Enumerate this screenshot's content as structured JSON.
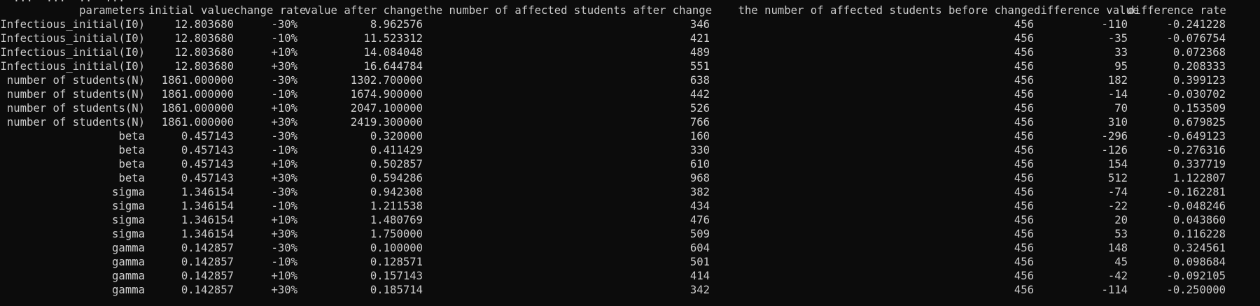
{
  "terminal": {
    "background": "#0c0c0c",
    "foreground": "#cccccc",
    "clipped_line": "  ...  ...  ..  ..."
  },
  "table": {
    "headers": [
      "parameters",
      "initial value",
      "change rate",
      "value after change",
      "the number of affected students after change",
      "the number of affected students before change",
      "difference value",
      "difference rate"
    ],
    "rows": [
      [
        "Infectious_initial(I0)",
        "12.803680",
        "-30%",
        "8.962576",
        "346",
        "456",
        "-110",
        "-0.241228"
      ],
      [
        "Infectious_initial(I0)",
        "12.803680",
        "-10%",
        "11.523312",
        "421",
        "456",
        "-35",
        "-0.076754"
      ],
      [
        "Infectious_initial(I0)",
        "12.803680",
        "+10%",
        "14.084048",
        "489",
        "456",
        "33",
        "0.072368"
      ],
      [
        "Infectious_initial(I0)",
        "12.803680",
        "+30%",
        "16.644784",
        "551",
        "456",
        "95",
        "0.208333"
      ],
      [
        "number of students(N)",
        "1861.000000",
        "-30%",
        "1302.700000",
        "638",
        "456",
        "182",
        "0.399123"
      ],
      [
        "number of students(N)",
        "1861.000000",
        "-10%",
        "1674.900000",
        "442",
        "456",
        "-14",
        "-0.030702"
      ],
      [
        "number of students(N)",
        "1861.000000",
        "+10%",
        "2047.100000",
        "526",
        "456",
        "70",
        "0.153509"
      ],
      [
        "number of students(N)",
        "1861.000000",
        "+30%",
        "2419.300000",
        "766",
        "456",
        "310",
        "0.679825"
      ],
      [
        "beta",
        "0.457143",
        "-30%",
        "0.320000",
        "160",
        "456",
        "-296",
        "-0.649123"
      ],
      [
        "beta",
        "0.457143",
        "-10%",
        "0.411429",
        "330",
        "456",
        "-126",
        "-0.276316"
      ],
      [
        "beta",
        "0.457143",
        "+10%",
        "0.502857",
        "610",
        "456",
        "154",
        "0.337719"
      ],
      [
        "beta",
        "0.457143",
        "+30%",
        "0.594286",
        "968",
        "456",
        "512",
        "1.122807"
      ],
      [
        "sigma",
        "1.346154",
        "-30%",
        "0.942308",
        "382",
        "456",
        "-74",
        "-0.162281"
      ],
      [
        "sigma",
        "1.346154",
        "-10%",
        "1.211538",
        "434",
        "456",
        "-22",
        "-0.048246"
      ],
      [
        "sigma",
        "1.346154",
        "+10%",
        "1.480769",
        "476",
        "456",
        "20",
        "0.043860"
      ],
      [
        "sigma",
        "1.346154",
        "+30%",
        "1.750000",
        "509",
        "456",
        "53",
        "0.116228"
      ],
      [
        "gamma",
        "0.142857",
        "-30%",
        "0.100000",
        "604",
        "456",
        "148",
        "0.324561"
      ],
      [
        "gamma",
        "0.142857",
        "-10%",
        "0.128571",
        "501",
        "456",
        "45",
        "0.098684"
      ],
      [
        "gamma",
        "0.142857",
        "+10%",
        "0.157143",
        "414",
        "456",
        "-42",
        "-0.092105"
      ],
      [
        "gamma",
        "0.142857",
        "+30%",
        "0.185714",
        "342",
        "456",
        "-114",
        "-0.250000"
      ]
    ]
  }
}
